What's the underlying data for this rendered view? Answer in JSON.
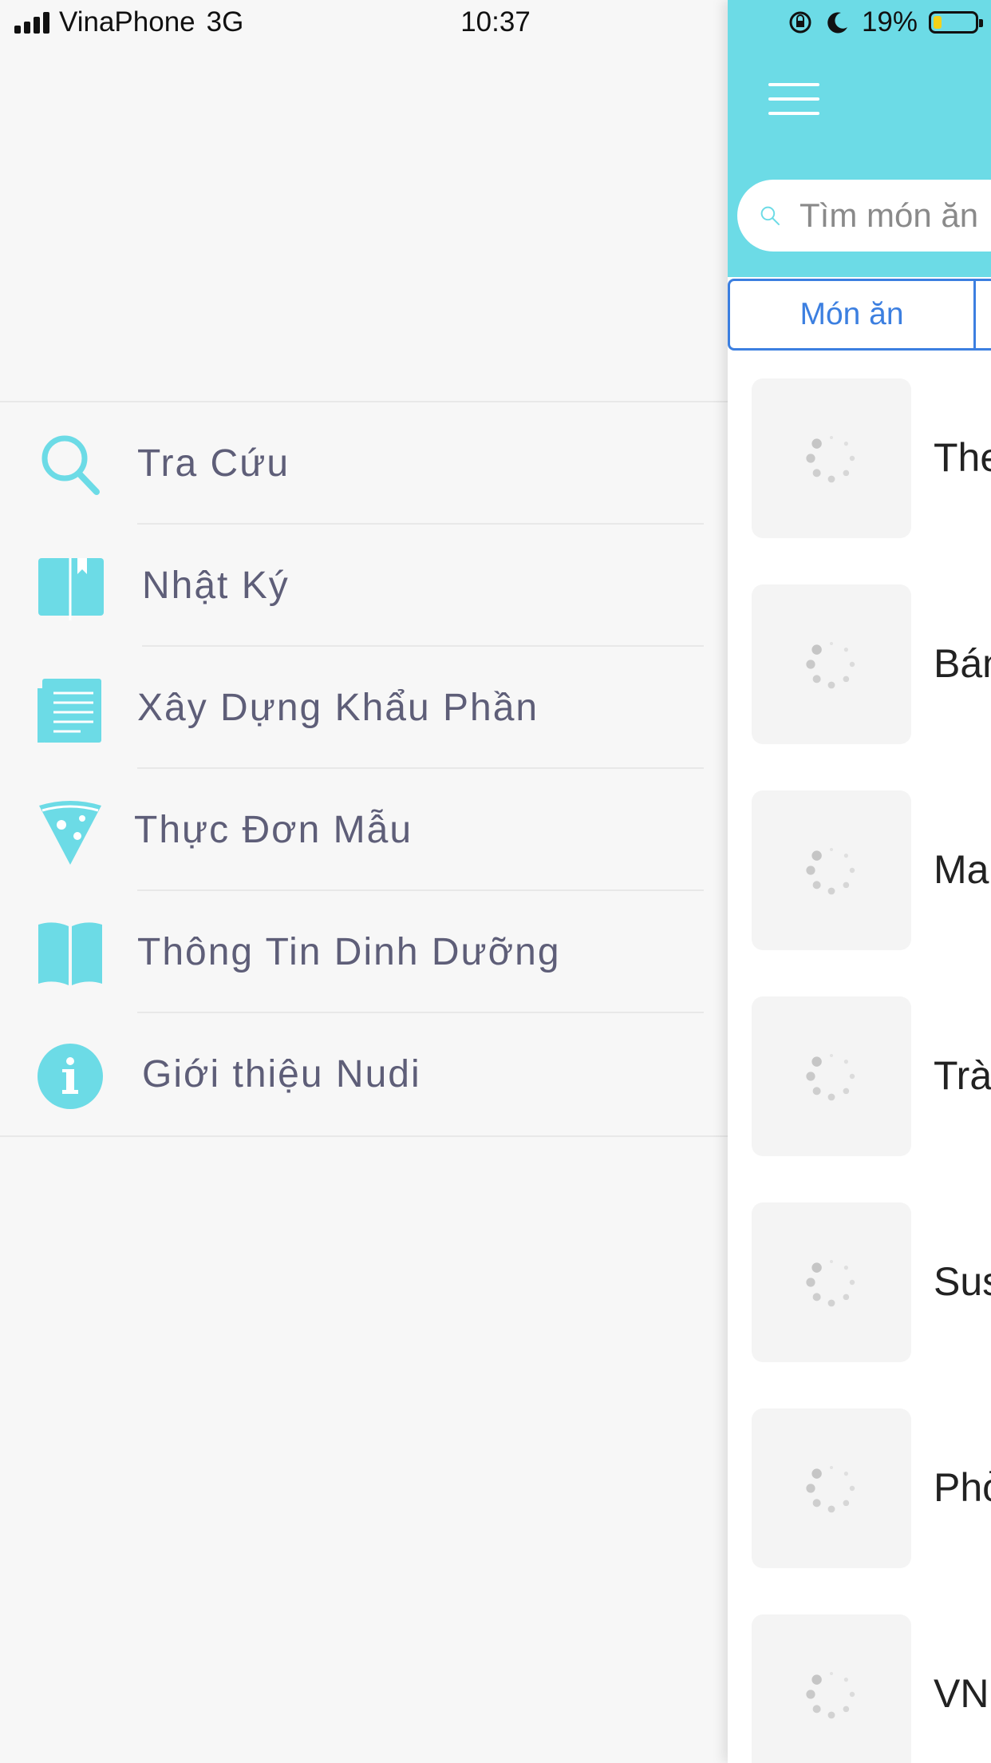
{
  "status_bar": {
    "carrier": "VinaPhone",
    "network": "3G",
    "time": "10:37",
    "battery": "19%",
    "icons": [
      "signal-icon",
      "orientation-lock-icon",
      "moon-icon",
      "battery-icon"
    ]
  },
  "colors": {
    "accent": "#6cdbe6",
    "tab_blue": "#3c7fe0",
    "menu_text": "#5e5e78",
    "background": "#f7f7f7"
  },
  "menu": {
    "items": [
      {
        "label": "Tra Cứu",
        "icon": "search-icon"
      },
      {
        "label": "Nhật Ký",
        "icon": "diary-book-icon"
      },
      {
        "label": "Xây Dựng Khẩu Phần",
        "icon": "document-list-icon"
      },
      {
        "label": "Thực Đơn Mẫu",
        "icon": "pizza-slice-icon"
      },
      {
        "label": "Thông Tin Dinh Dưỡng",
        "icon": "open-book-icon"
      },
      {
        "label": "Giới thiệu Nudi",
        "icon": "info-icon"
      }
    ]
  },
  "header": {
    "menu_icon": "hamburger-icon",
    "search_placeholder": "Tìm món ăn"
  },
  "tabs": [
    {
      "label": "Món ăn",
      "active": true
    }
  ],
  "food_list": [
    {
      "name": "The"
    },
    {
      "name": "Bán"
    },
    {
      "name": "Mai"
    },
    {
      "name": "Trà"
    },
    {
      "name": "Sus"
    },
    {
      "name": "Phở"
    },
    {
      "name": "VN"
    }
  ]
}
